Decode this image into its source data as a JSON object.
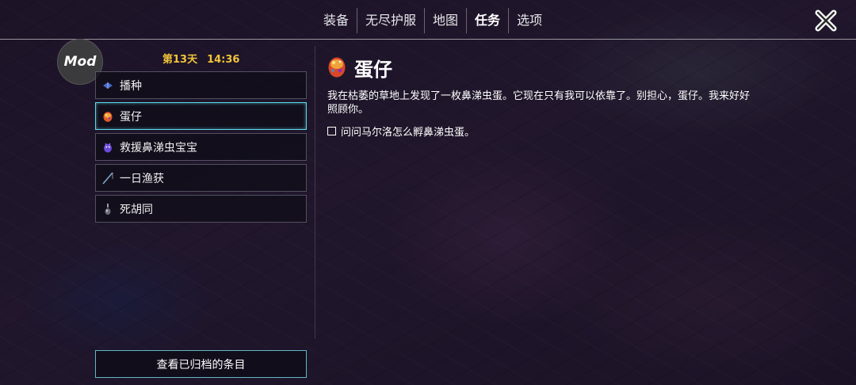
{
  "nav": {
    "tabs": [
      {
        "label": "装备"
      },
      {
        "label": "无尽护服"
      },
      {
        "label": "地图"
      },
      {
        "label": "任务"
      },
      {
        "label": "选项"
      }
    ],
    "active_tab": "任务",
    "close_icon": "close-icon"
  },
  "badge": {
    "label": "Mod"
  },
  "status": {
    "day": "第13天",
    "time": "14:36",
    "color": "#f0c43a"
  },
  "quests": [
    {
      "label": "播种",
      "icon": "seed-icon"
    },
    {
      "label": "蛋仔",
      "icon": "egg-icon"
    },
    {
      "label": "救援鼻涕虫宝宝",
      "icon": "slug-icon"
    },
    {
      "label": "一日渔获",
      "icon": "fishing-rod-icon"
    },
    {
      "label": "死胡同",
      "icon": "bottle-icon"
    }
  ],
  "selected_quest": "蛋仔",
  "detail": {
    "icon": "egg-icon",
    "title": "蛋仔",
    "description": "我在枯萎的草地上发现了一枚鼻涕虫蛋。它现在只有我可以依靠了。别担心，蛋仔。我来好好照顾你。",
    "tasks": [
      {
        "text": "问问马尔洛怎么孵鼻涕虫蛋。",
        "done": false
      }
    ]
  },
  "archive_button": {
    "label": "查看已归档的条目"
  },
  "colors": {
    "accent": "#5fd6e8",
    "highlight": "#f0c43a"
  }
}
